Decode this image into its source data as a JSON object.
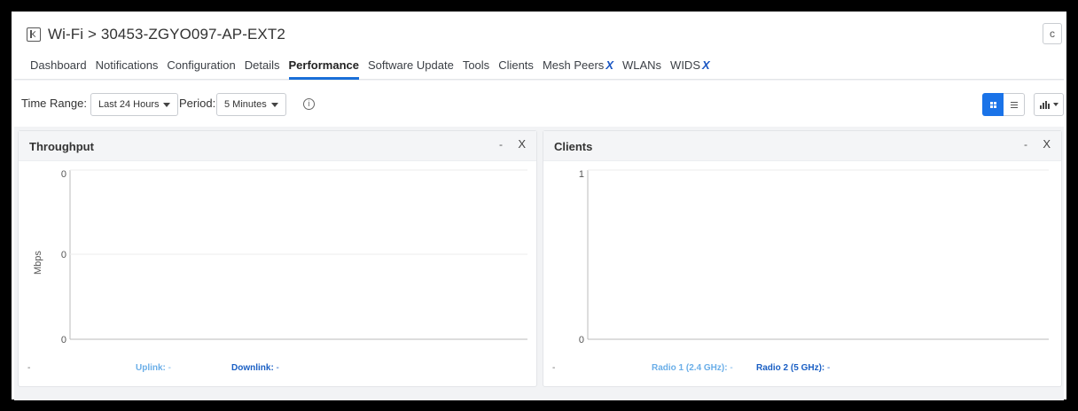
{
  "header": {
    "title": "Wi-Fi > 30453-ZGYO097-AP-EXT2",
    "refresh_label": "c"
  },
  "tabs": [
    {
      "label": "Dashboard"
    },
    {
      "label": "Notifications"
    },
    {
      "label": "Configuration"
    },
    {
      "label": "Details"
    },
    {
      "label": "Performance",
      "active": true
    },
    {
      "label": "Software Update"
    },
    {
      "label": "Tools"
    },
    {
      "label": "Clients"
    },
    {
      "label": "Mesh Peers",
      "mark": "X"
    },
    {
      "label": "WLANs"
    },
    {
      "label": "WIDS",
      "mark": "X"
    }
  ],
  "toolbar": {
    "time_range_label": "Time Range:",
    "time_range_value": "Last 24 Hours",
    "period_label": "Period:",
    "period_value": "5 Minutes",
    "info_glyph": "i"
  },
  "colors": {
    "accent": "#1a73e8",
    "series_light": "#6aaee8",
    "series_dark": "#1a5fc4"
  },
  "cards": {
    "throughput": {
      "title": "Throughput",
      "min_glyph": "-",
      "close_glyph": "X",
      "y_label": "Mbps",
      "y_ticks": [
        "0",
        "0",
        "0"
      ],
      "legend_dash": "-",
      "legend": [
        {
          "name": "Uplink:",
          "value": " -"
        },
        {
          "name": "Downlink:",
          "value": " -"
        }
      ]
    },
    "clients": {
      "title": "Clients",
      "min_glyph": "-",
      "close_glyph": "X",
      "y_ticks": [
        "1",
        "0"
      ],
      "legend_dash": "-",
      "legend": [
        {
          "name": "Radio 1 (2.4 GHz):",
          "value": " -"
        },
        {
          "name": "Radio 2 (5 GHz):",
          "value": " -"
        }
      ]
    }
  }
}
